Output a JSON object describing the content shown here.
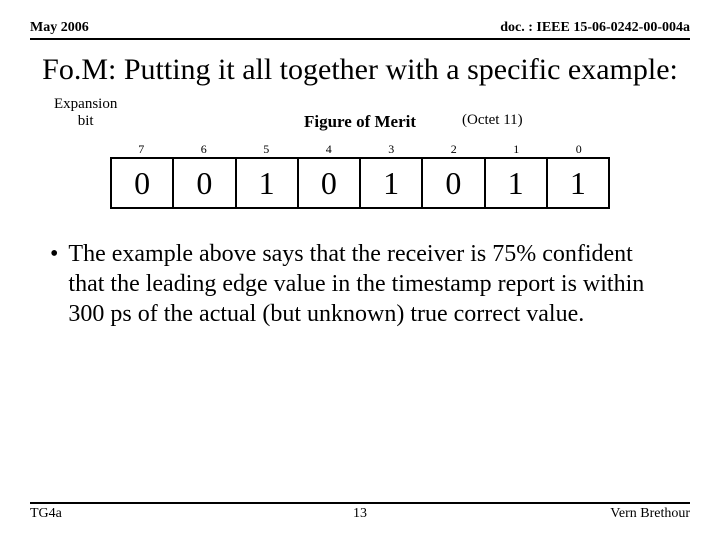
{
  "header": {
    "date": "May 2006",
    "doc": "doc. : IEEE 15-06-0242-00-004a"
  },
  "title": "Fo.M: Putting it all together with a specific example:",
  "expansion_bit_line1": "Expansion",
  "expansion_bit_line2": "bit",
  "figure_of_merit": "Figure of Merit",
  "octet": "(Octet 11)",
  "bit_indices": [
    "7",
    "6",
    "5",
    "4",
    "3",
    "2",
    "1",
    "0"
  ],
  "bit_values": [
    "0",
    "0",
    "1",
    "0",
    "1",
    "0",
    "1",
    "1"
  ],
  "bullet_dot": "•",
  "bullet_text": "The example above says that the receiver is 75% confident that the leading edge value in the timestamp report is within 300 ps of the actual (but unknown) true correct value.",
  "footer": {
    "left": "TG4a",
    "page": "13",
    "right": "Vern Brethour"
  }
}
